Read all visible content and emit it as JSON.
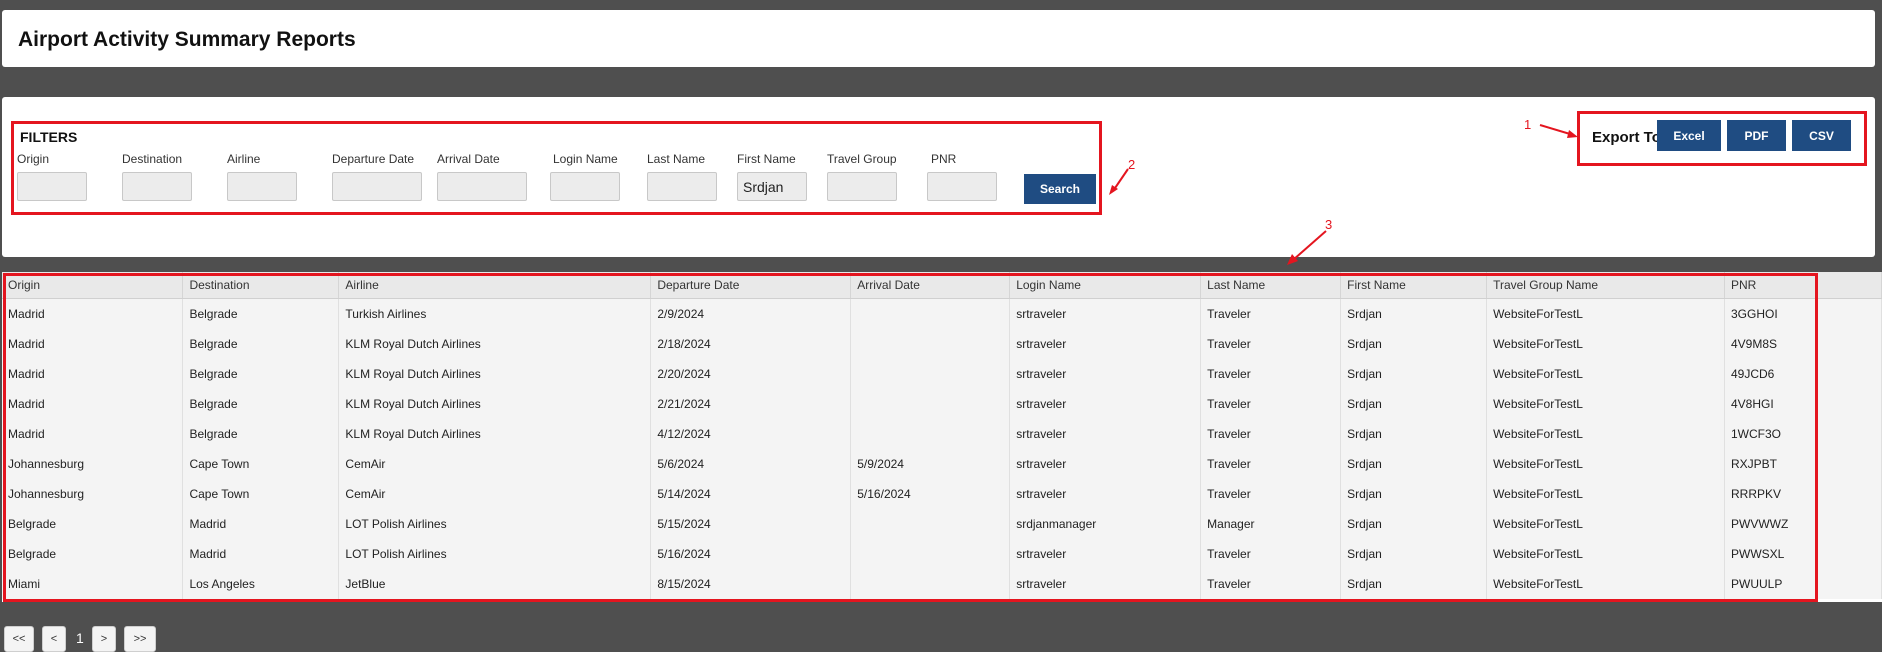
{
  "page_title": "Airport Activity Summary Reports",
  "filters": {
    "heading": "FILTERS",
    "fields": [
      {
        "label": "Origin",
        "value": ""
      },
      {
        "label": "Destination",
        "value": ""
      },
      {
        "label": "Airline",
        "value": ""
      },
      {
        "label": "Departure Date",
        "value": ""
      },
      {
        "label": "Arrival Date",
        "value": ""
      },
      {
        "label": "Login Name",
        "value": ""
      },
      {
        "label": "Last Name",
        "value": ""
      },
      {
        "label": "First Name",
        "value": "Srdjan"
      },
      {
        "label": "Travel Group",
        "value": ""
      },
      {
        "label": "PNR",
        "value": ""
      }
    ],
    "search_label": "Search"
  },
  "export": {
    "label": "Export To",
    "buttons": [
      "Excel",
      "PDF",
      "CSV"
    ]
  },
  "annotations": [
    "1",
    "2",
    "3"
  ],
  "table": {
    "columns": [
      "Origin",
      "Destination",
      "Airline",
      "Departure Date",
      "Arrival Date",
      "Login Name",
      "Last Name",
      "First Name",
      "Travel Group Name",
      "PNR"
    ],
    "rows": [
      [
        "Madrid",
        "Belgrade",
        "Turkish Airlines",
        "2/9/2024",
        "",
        "srtraveler",
        "Traveler",
        "Srdjan",
        "WebsiteForTestL",
        "3GGHOI"
      ],
      [
        "Madrid",
        "Belgrade",
        "KLM Royal Dutch Airlines",
        "2/18/2024",
        "",
        "srtraveler",
        "Traveler",
        "Srdjan",
        "WebsiteForTestL",
        "4V9M8S"
      ],
      [
        "Madrid",
        "Belgrade",
        "KLM Royal Dutch Airlines",
        "2/20/2024",
        "",
        "srtraveler",
        "Traveler",
        "Srdjan",
        "WebsiteForTestL",
        "49JCD6"
      ],
      [
        "Madrid",
        "Belgrade",
        "KLM Royal Dutch Airlines",
        "2/21/2024",
        "",
        "srtraveler",
        "Traveler",
        "Srdjan",
        "WebsiteForTestL",
        "4V8HGI"
      ],
      [
        "Madrid",
        "Belgrade",
        "KLM Royal Dutch Airlines",
        "4/12/2024",
        "",
        "srtraveler",
        "Traveler",
        "Srdjan",
        "WebsiteForTestL",
        "1WCF3O"
      ],
      [
        "Johannesburg",
        "Cape Town",
        "CemAir",
        "5/6/2024",
        "5/9/2024",
        "srtraveler",
        "Traveler",
        "Srdjan",
        "WebsiteForTestL",
        "RXJPBT"
      ],
      [
        "Johannesburg",
        "Cape Town",
        "CemAir",
        "5/14/2024",
        "5/16/2024",
        "srtraveler",
        "Traveler",
        "Srdjan",
        "WebsiteForTestL",
        "RRRPKV"
      ],
      [
        "Belgrade",
        "Madrid",
        "LOT Polish Airlines",
        "5/15/2024",
        "",
        "srdjanmanager",
        "Manager",
        "Srdjan",
        "WebsiteForTestL",
        "PWVWWZ"
      ],
      [
        "Belgrade",
        "Madrid",
        "LOT Polish Airlines",
        "5/16/2024",
        "",
        "srtraveler",
        "Traveler",
        "Srdjan",
        "WebsiteForTestL",
        "PWWSXL"
      ],
      [
        "Miami",
        "Los Angeles",
        "JetBlue",
        "8/15/2024",
        "",
        "srtraveler",
        "Traveler",
        "Srdjan",
        "WebsiteForTestL",
        "PWUULP"
      ]
    ]
  },
  "pagination": {
    "first": "<<",
    "prev": "<",
    "current": "1",
    "next": ">",
    "last": ">>"
  }
}
